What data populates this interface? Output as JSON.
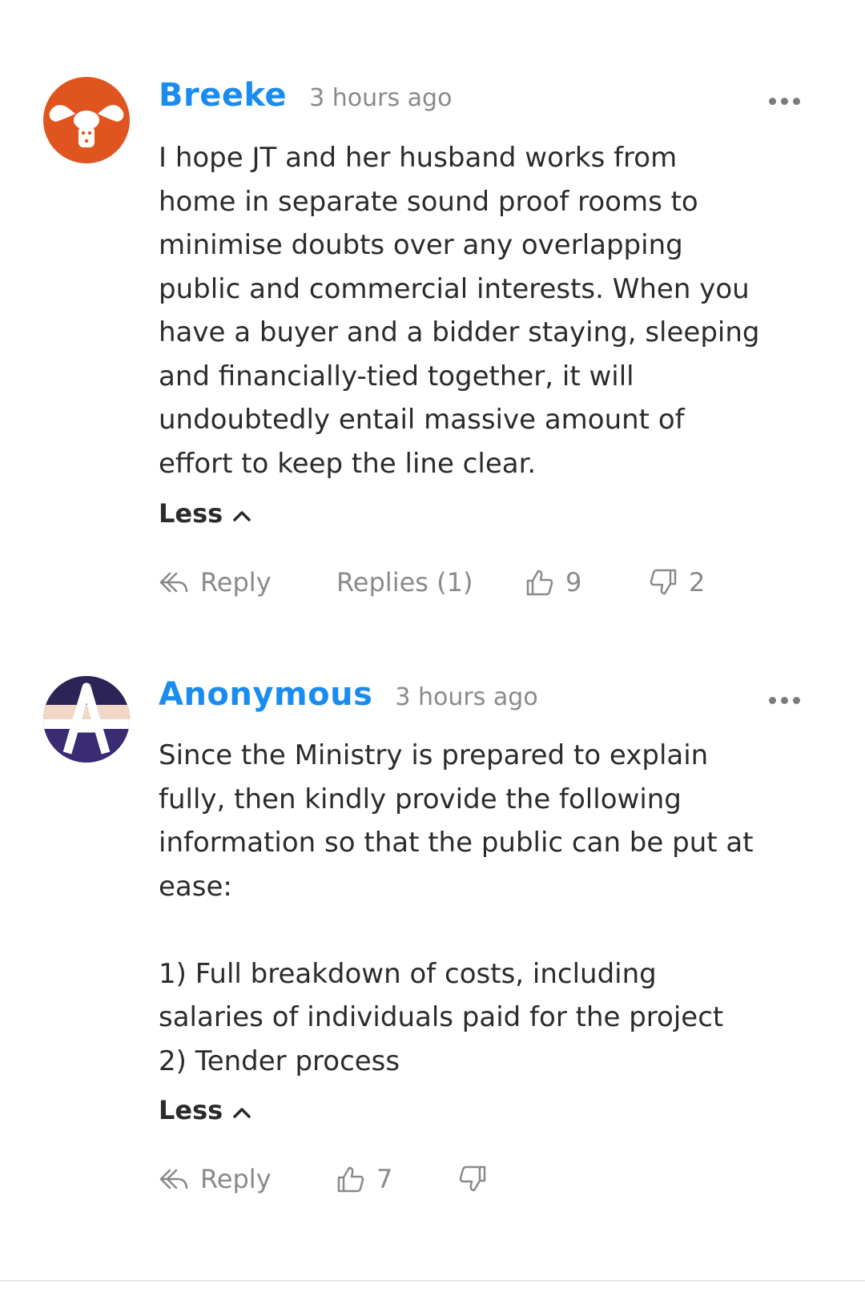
{
  "comments": [
    {
      "author": "Breeke",
      "time": "3 hours ago",
      "text": "I hope JT and her husband works from\nhome in separate sound proof rooms to\nminimise doubts over any overlapping\npublic and commercial interests. When you\nhave a buyer and a bidder staying, sleeping\nand financially-tied together, it will\nundoubtedly entail massive amount of\neffort to keep the line clear.",
      "less_label": "Less",
      "reply_label": "Reply",
      "replies_label": "Replies (1)",
      "likes": "9",
      "dislikes": "2",
      "avatar_color": "#e0551f"
    },
    {
      "author": "Anonymous",
      "time": "3 hours ago",
      "text": "Since the Ministry is prepared to explain\nfully, then kindly provide the following\ninformation so that the public can be put at\nease:\n\n1) Full breakdown of costs, including\nsalaries of individuals paid for the project\n2) Tender process",
      "less_label": "Less",
      "reply_label": "Reply",
      "likes": "7",
      "avatar_letter": "A"
    }
  ],
  "colors": {
    "author": "#1a8cf0",
    "meta": "#8a8a8a",
    "text": "#2b2b2b"
  }
}
